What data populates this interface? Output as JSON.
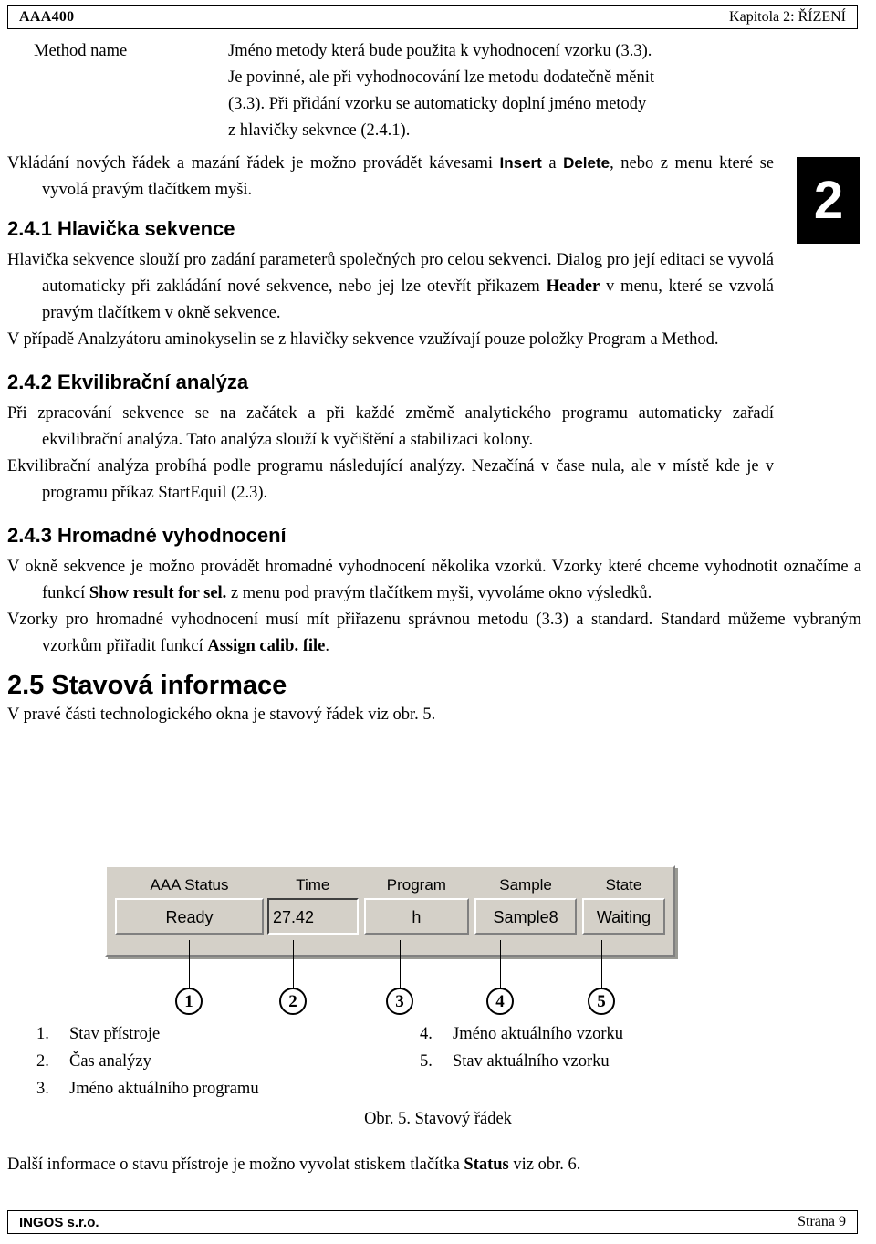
{
  "header": {
    "left": "AAA400",
    "right": "Kapitola 2: ŘÍZENÍ"
  },
  "chapter_tab": "2",
  "definition": {
    "term": "Method name",
    "lines": [
      "Jméno metody která bude použita k vyhodnocení vzorku (3.3).",
      "Je povinné, ale při vyhodnocování lze metodu dodatečně měnit",
      "(3.3). Při přidání vzorku se automaticky doplní jméno metody",
      "z hlavičky sekvnce (2.4.1)."
    ]
  },
  "intro_paragraph": {
    "part1": "Vkládání nových řádek a mazání řádek je možno provádět kávesami ",
    "bold1": "Insert",
    "part2": " a ",
    "bold2": "Delete",
    "part3": ", nebo z menu které se vyvolá pravým tlačítkem myši."
  },
  "sections": [
    {
      "heading": "2.4.1 Hlavička sekvence",
      "paragraphs": [
        {
          "part1": "Hlavička sekvence slouží pro zadání parameterů společných pro celou sekvenci. Dialog pro její editaci se vyvolá automaticky při zakládání nové sekvence, nebo jej lze otevřít přikazem ",
          "bold1": "Header",
          "part2": " v menu, které se vzvolá pravým tlačítkem v okně sekvence."
        },
        {
          "part1": "V případě Analzyátoru aminokyselin se z hlavičky sekvence vzužívají pouze položky Program a Method.",
          "bold1": "",
          "part2": ""
        }
      ]
    },
    {
      "heading": "2.4.2 Ekvilibrační analýza",
      "paragraphs": [
        {
          "part1": "Při zpracování sekvence se na začátek a při každé změmě analytického programu automaticky zařadí ekvilibrační analýza. Tato analýza slouží k vyčištění a stabilizaci kolony.",
          "bold1": "",
          "part2": ""
        },
        {
          "part1": "Ekvilibrační analýza probíhá podle programu následující analýzy. Nezačíná v čase nula, ale v místě kde je v programu příkaz StartEquil (2.3).",
          "bold1": "",
          "part2": ""
        }
      ]
    }
  ],
  "section_243": {
    "heading": "2.4.3 Hromadné vyhodnocení",
    "p1_part1": "V okně sekvence je možno provádět hromadné vyhodnocení několika vzorků. Vzorky které chceme vyhodnotit označíme a funkcí ",
    "p1_bold": "Show result for sel.",
    "p1_part2": " z menu pod pravým tlačítkem myši, vyvoláme okno výsledků.",
    "p2_part1": "Vzorky pro hromadné vyhodnocení musí mít přiřazenu správnou metodu (3.3) a standard. Standard můžeme vybraným vzorkům přiřadit funkcí ",
    "p2_bold": "Assign calib. file",
    "p2_part2": "."
  },
  "section_25": {
    "heading": "2.5 Stavová informace",
    "paragraph": "V pravé části technologického okna je stavový řádek viz obr. 5."
  },
  "status_bar": {
    "columns": [
      {
        "label": "AAA Status",
        "value": "Ready",
        "style": "raised"
      },
      {
        "label": "Time",
        "value": "27.42",
        "style": "sunken"
      },
      {
        "label": "Program",
        "value": "h",
        "style": "raised"
      },
      {
        "label": "Sample",
        "value": "Sample8",
        "style": "raised"
      },
      {
        "label": "State",
        "value": "Waiting",
        "style": "raised"
      }
    ]
  },
  "callouts": [
    "1",
    "2",
    "3",
    "4",
    "5"
  ],
  "legend_left": [
    {
      "num": "1.",
      "text": "Stav přístroje"
    },
    {
      "num": "2.",
      "text": "Čas analýzy"
    },
    {
      "num": "3.",
      "text": "Jméno aktuálního programu"
    }
  ],
  "legend_right": [
    {
      "num": "4.",
      "text": "Jméno aktuálního vzorku"
    },
    {
      "num": "5.",
      "text": "Stav aktuálního vzorku"
    }
  ],
  "figure_caption": "Obr.  5.  Stavový řádek",
  "tail": {
    "part1": "Další informace o stavu přístroje je možno vyvolat stiskem tlačítka ",
    "bold": "Status",
    "part2": " viz obr. 6."
  },
  "footer": {
    "left": "INGOS s.r.o.",
    "right": "Strana 9"
  }
}
